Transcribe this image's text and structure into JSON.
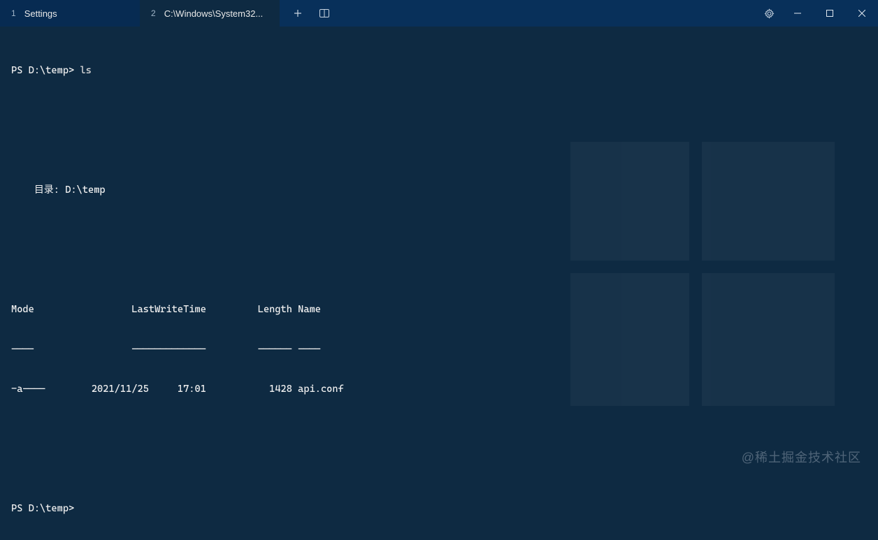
{
  "titlebar": {
    "tabs": [
      {
        "index": "1",
        "label": "Settings",
        "active": false
      },
      {
        "index": "2",
        "label": "C:\\Windows\\System32...",
        "active": true
      }
    ]
  },
  "terminal": {
    "prompt1": "PS D:\\temp> ",
    "command1": "ls",
    "blank1": "",
    "blank2": "",
    "dir_header": "    目录: D:\\temp",
    "blank3": "",
    "blank4": "",
    "col_header": "Mode                 LastWriteTime         Length Name",
    "col_divider": "----                 -------------         ------ ----",
    "row1": "-a----        2021/11/25     17:01           1428 api.conf",
    "blank5": "",
    "blank6": "",
    "prompt2": "PS D:\\temp>"
  },
  "watermark": "@稀土掘金技术社区"
}
